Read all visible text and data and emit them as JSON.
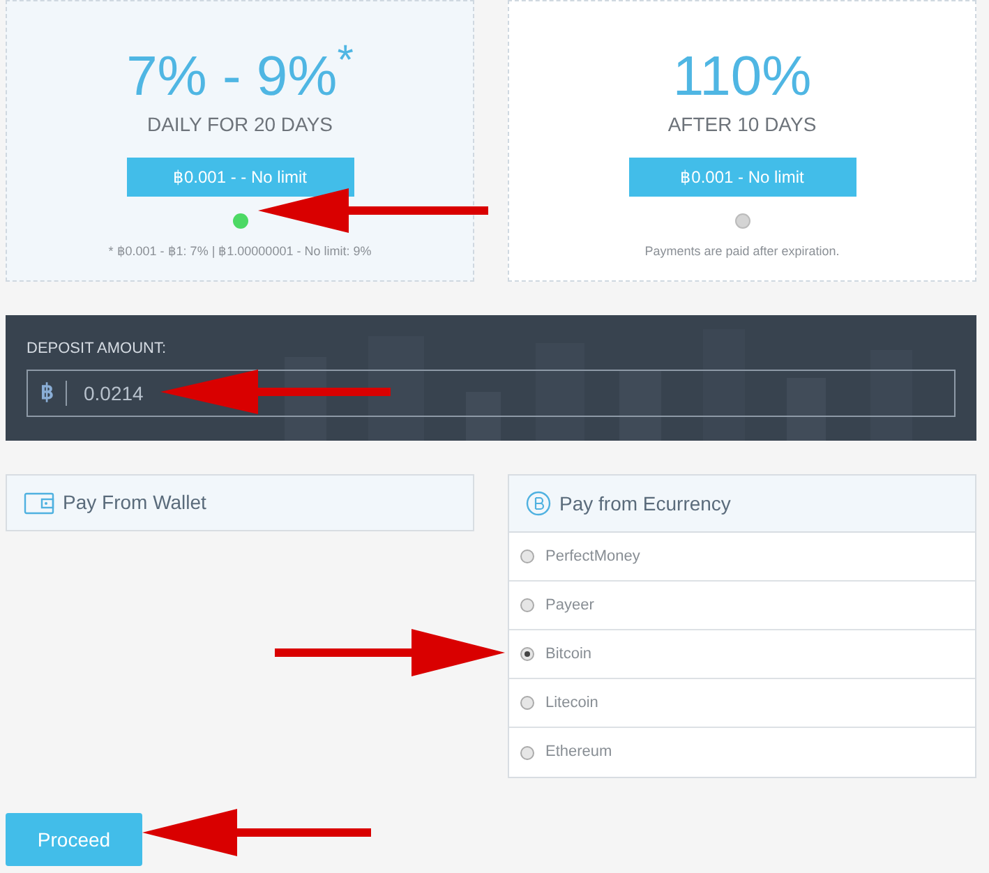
{
  "plans": [
    {
      "rate": "7% - 9%$^{*}$",
      "term": "DAILY FOR 20 DAYS",
      "range": "฿0.001 - - No limit",
      "selected": true,
      "note": "* ฿0.001 - ฿1: 7% | ฿1.00000001 - No limit: 9%"
    },
    {
      "rate": "110%",
      "term": "AFTER 10 DAYS",
      "range": "฿0.001 - No limit",
      "selected": false,
      "note": "Payments are paid after expiration."
    }
  ],
  "deposit": {
    "label": "DEPOSIT AMOUNT:",
    "currency_symbol": "฿",
    "value": "0.0214"
  },
  "wallet": {
    "title": "Pay From Wallet"
  },
  "ecurrency": {
    "title": "Pay from Ecurrency",
    "options": [
      {
        "label": "PerfectMoney",
        "selected": false
      },
      {
        "label": "Payeer",
        "selected": false
      },
      {
        "label": "Bitcoin",
        "selected": true
      },
      {
        "label": "Litecoin",
        "selected": false
      },
      {
        "label": "Ethereum",
        "selected": false
      }
    ]
  },
  "proceed": "Proceed"
}
